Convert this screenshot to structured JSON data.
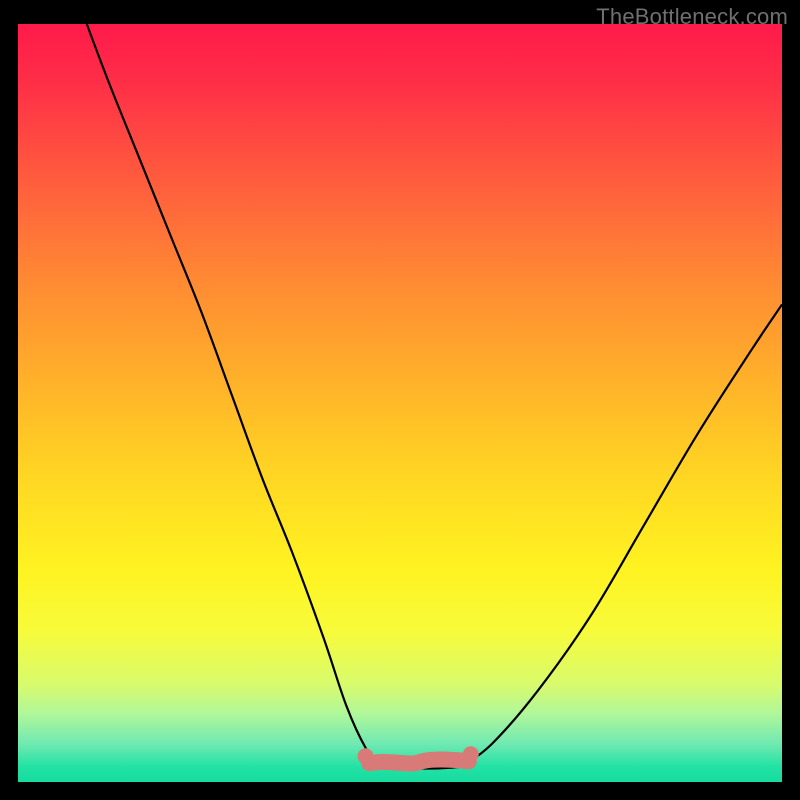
{
  "watermark": "TheBottleneck.com",
  "chart_data": {
    "type": "line",
    "title": "",
    "xlabel": "",
    "ylabel": "",
    "xlim": [
      0,
      100
    ],
    "ylim": [
      0,
      100
    ],
    "series": [
      {
        "name": "left-curve",
        "x": [
          9,
          12,
          16,
          20,
          24,
          28,
          32,
          36,
          40,
          43,
          45.5,
          47.5
        ],
        "y": [
          100,
          92,
          82,
          72,
          62,
          51,
          40,
          30,
          19,
          10,
          4.5,
          2
        ]
      },
      {
        "name": "flat-bottom",
        "x": [
          47.5,
          50,
          55,
          58
        ],
        "y": [
          2,
          1.8,
          1.8,
          2
        ]
      },
      {
        "name": "right-curve",
        "x": [
          58,
          62,
          68,
          75,
          82,
          89,
          96,
          100
        ],
        "y": [
          2,
          5,
          12,
          22,
          34,
          46,
          57,
          63
        ]
      }
    ],
    "annotations": [
      {
        "name": "pink-flat-marker",
        "x_range": [
          46,
          59
        ],
        "y": 2.6
      }
    ],
    "colors": {
      "curve": "#000000",
      "marker": "#d87a78"
    }
  }
}
